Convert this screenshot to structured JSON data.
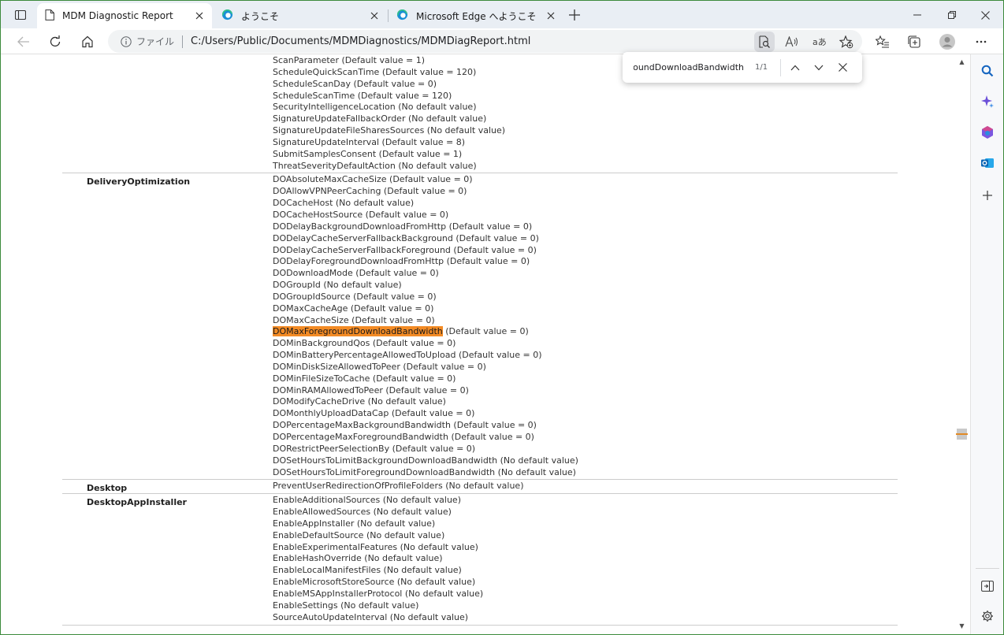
{
  "tabs": [
    {
      "title": "MDM Diagnostic Report",
      "icon": "document-icon",
      "active": true
    },
    {
      "title": "ようこそ",
      "icon": "edge-icon",
      "active": false
    },
    {
      "title": "Microsoft Edge へようこそ",
      "icon": "edge-icon",
      "active": false
    }
  ],
  "address": {
    "scheme_label": "ファイル",
    "url": "C:/Users/Public/Documents/MDMDiagnostics/MDMDiagReport.html"
  },
  "find": {
    "query": "DOMaxForegroundDownloadBandwidth",
    "count": "1/1"
  },
  "report": {
    "sections": [
      {
        "area": "",
        "policies": [
          {
            "name": "ScanParameter",
            "note": " (Default value = 1)"
          },
          {
            "name": "ScheduleQuickScanTime",
            "note": " (Default value = 120)"
          },
          {
            "name": "ScheduleScanDay",
            "note": " (Default value = 0)"
          },
          {
            "name": "ScheduleScanTime",
            "note": " (Default value = 120)"
          },
          {
            "name": "SecurityIntelligenceLocation",
            "note": " (No default value)"
          },
          {
            "name": "SignatureUpdateFallbackOrder",
            "note": " (No default value)"
          },
          {
            "name": "SignatureUpdateFileSharesSources",
            "note": " (No default value)"
          },
          {
            "name": "SignatureUpdateInterval",
            "note": " (Default value = 8)"
          },
          {
            "name": "SubmitSamplesConsent",
            "note": " (Default value = 1)"
          },
          {
            "name": "ThreatSeverityDefaultAction",
            "note": " (No default value)"
          }
        ]
      },
      {
        "area": "DeliveryOptimization",
        "policies": [
          {
            "name": "DOAbsoluteMaxCacheSize",
            "note": " (Default value = 0)"
          },
          {
            "name": "DOAllowVPNPeerCaching",
            "note": " (Default value = 0)"
          },
          {
            "name": "DOCacheHost",
            "note": " (No default value)"
          },
          {
            "name": "DOCacheHostSource",
            "note": " (Default value = 0)"
          },
          {
            "name": "DODelayBackgroundDownloadFromHttp",
            "note": " (Default value = 0)"
          },
          {
            "name": "DODelayCacheServerFallbackBackground",
            "note": " (Default value = 0)"
          },
          {
            "name": "DODelayCacheServerFallbackForeground",
            "note": " (Default value = 0)"
          },
          {
            "name": "DODelayForegroundDownloadFromHttp",
            "note": " (Default value = 0)"
          },
          {
            "name": "DODownloadMode",
            "note": " (Default value = 0)"
          },
          {
            "name": "DOGroupId",
            "note": " (No default value)"
          },
          {
            "name": "DOGroupIdSource",
            "note": " (Default value = 0)"
          },
          {
            "name": "DOMaxCacheAge",
            "note": " (Default value = 0)"
          },
          {
            "name": "DOMaxCacheSize",
            "note": " (Default value = 0)"
          },
          {
            "name": "DOMaxForegroundDownloadBandwidth",
            "note": " (Default value = 0)",
            "highlight": true
          },
          {
            "name": "DOMinBackgroundQos",
            "note": " (Default value = 0)"
          },
          {
            "name": "DOMinBatteryPercentageAllowedToUpload",
            "note": " (Default value = 0)"
          },
          {
            "name": "DOMinDiskSizeAllowedToPeer",
            "note": " (Default value = 0)"
          },
          {
            "name": "DOMinFileSizeToCache",
            "note": " (Default value = 0)"
          },
          {
            "name": "DOMinRAMAllowedToPeer",
            "note": " (Default value = 0)"
          },
          {
            "name": "DOModifyCacheDrive",
            "note": " (No default value)"
          },
          {
            "name": "DOMonthlyUploadDataCap",
            "note": " (Default value = 0)"
          },
          {
            "name": "DOPercentageMaxBackgroundBandwidth",
            "note": " (Default value = 0)"
          },
          {
            "name": "DOPercentageMaxForegroundBandwidth",
            "note": " (Default value = 0)"
          },
          {
            "name": "DORestrictPeerSelectionBy",
            "note": " (Default value = 0)"
          },
          {
            "name": "DOSetHoursToLimitBackgroundDownloadBandwidth",
            "note": " (No default value)"
          },
          {
            "name": "DOSetHoursToLimitForegroundDownloadBandwidth",
            "note": " (No default value)"
          }
        ]
      },
      {
        "area": "Desktop",
        "policies": [
          {
            "name": "PreventUserRedirectionOfProfileFolders",
            "note": " (No default value)"
          }
        ]
      },
      {
        "area": "DesktopAppInstaller",
        "policies": [
          {
            "name": "EnableAdditionalSources",
            "note": " (No default value)"
          },
          {
            "name": "EnableAllowedSources",
            "note": " (No default value)"
          },
          {
            "name": "EnableAppInstaller",
            "note": " (No default value)"
          },
          {
            "name": "EnableDefaultSource",
            "note": " (No default value)"
          },
          {
            "name": "EnableExperimentalFeatures",
            "note": " (No default value)"
          },
          {
            "name": "EnableHashOverride",
            "note": " (No default value)"
          },
          {
            "name": "EnableLocalManifestFiles",
            "note": " (No default value)"
          },
          {
            "name": "EnableMicrosoftStoreSource",
            "note": " (No default value)"
          },
          {
            "name": "EnableMSAppInstallerProtocol",
            "note": " (No default value)"
          },
          {
            "name": "EnableSettings",
            "note": " (No default value)"
          },
          {
            "name": "SourceAutoUpdateInterval",
            "note": " (No default value)"
          }
        ]
      }
    ]
  },
  "colors": {
    "highlight": "#f38b25",
    "window_border": "#3c8a3c",
    "tabbar_bg": "#e9eef4"
  }
}
